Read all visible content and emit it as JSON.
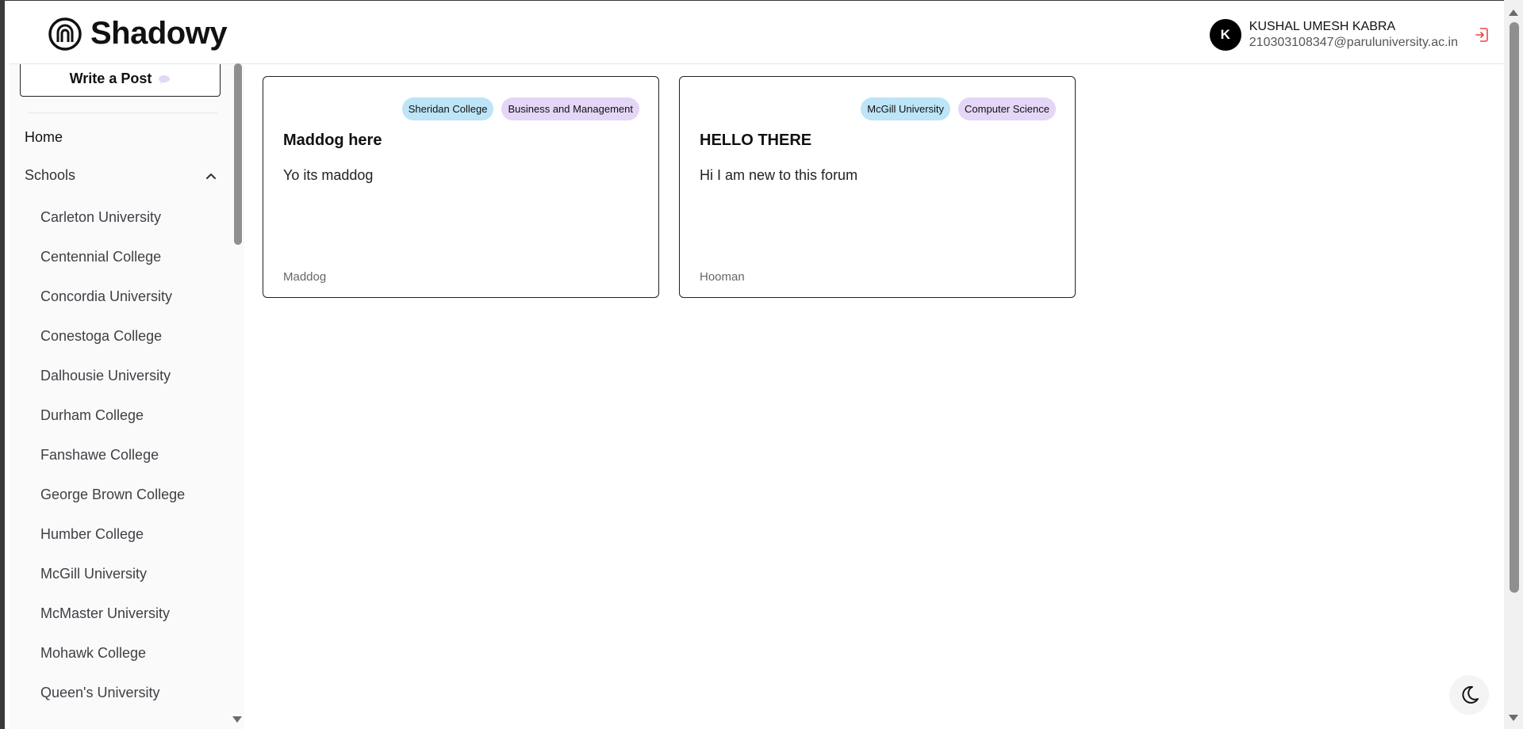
{
  "app": {
    "name": "Shadowy"
  },
  "user": {
    "initial": "K",
    "name": "KUSHAL UMESH KABRA",
    "email": "210303108347@paruluniversity.ac.in"
  },
  "sidebar": {
    "write_label": "Write a Post",
    "home_label": "Home",
    "schools_label": "Schools",
    "schools": [
      "Carleton University",
      "Centennial College",
      "Concordia University",
      "Conestoga College",
      "Dalhousie University",
      "Durham College",
      "Fanshawe College",
      "George Brown College",
      "Humber College",
      "McGill University",
      "McMaster University",
      "Mohawk College",
      "Queen's University"
    ]
  },
  "posts": [
    {
      "school": "Sheridan College",
      "major": "Business and Management",
      "title": "Maddog here",
      "body": "Yo its maddog",
      "author": "Maddog"
    },
    {
      "school": "McGill University",
      "major": "Computer Science",
      "title": "HELLO THERE",
      "body": "Hi I am new to this forum",
      "author": "Hooman"
    }
  ],
  "colors": {
    "school_tag": "#bde4f7",
    "major_tag": "#e3d6f6",
    "logout": "#ef4444"
  },
  "icons": {
    "logo": "shadowy-logo-icon",
    "logout": "logout-icon",
    "theme": "moon-icon"
  }
}
